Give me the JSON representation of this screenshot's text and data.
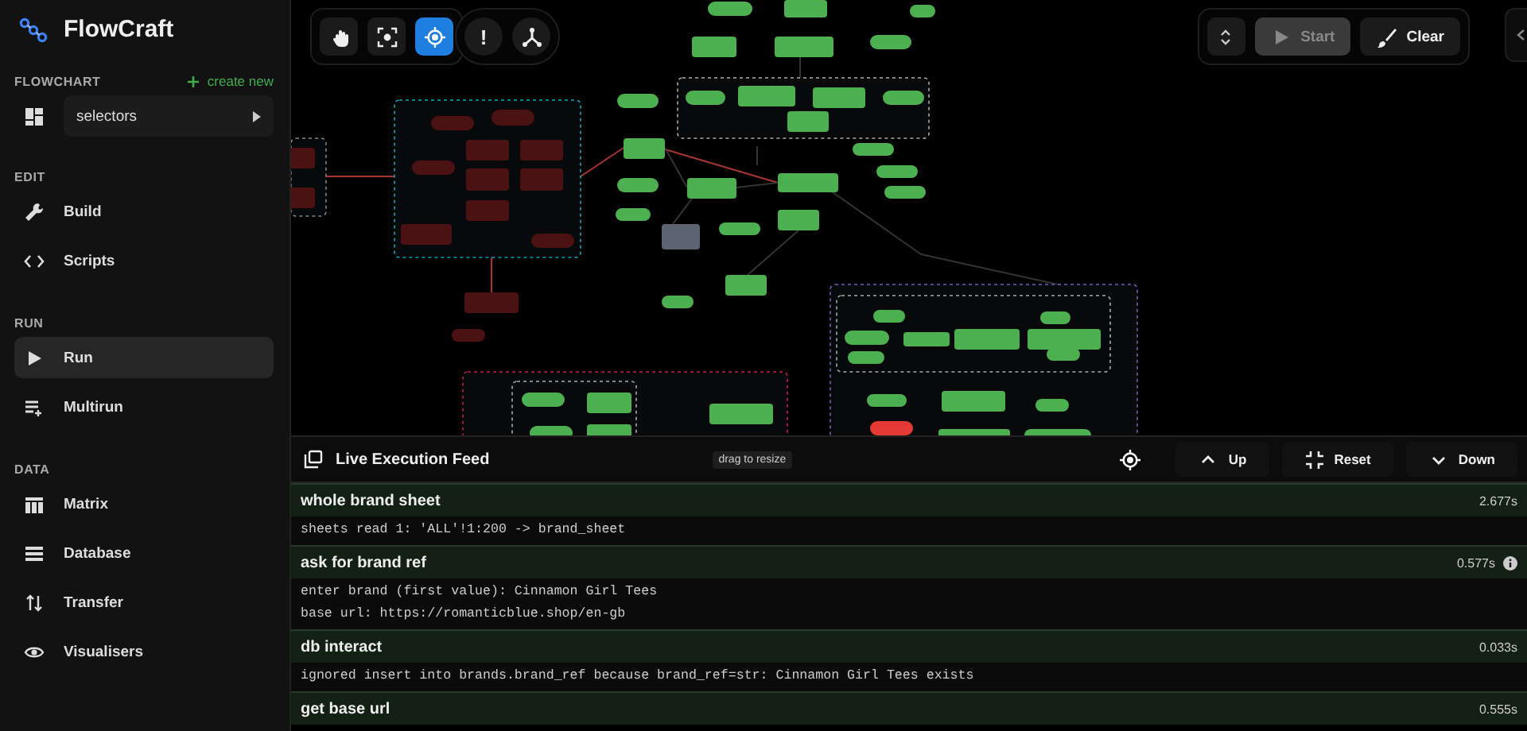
{
  "app": {
    "name": "FlowCraft"
  },
  "sidebar": {
    "sections": [
      {
        "title": "FLOWCHART",
        "action": "create new",
        "items": [
          {
            "label": "selectors",
            "kind": "picker",
            "selected": false
          }
        ]
      },
      {
        "title": "EDIT",
        "items": [
          {
            "label": "Build",
            "kind": "nav",
            "selected": false
          },
          {
            "label": "Scripts",
            "kind": "nav",
            "selected": false
          }
        ]
      },
      {
        "title": "RUN",
        "items": [
          {
            "label": "Run",
            "kind": "nav",
            "selected": true
          },
          {
            "label": "Multirun",
            "kind": "nav",
            "selected": false
          }
        ]
      },
      {
        "title": "DATA",
        "items": [
          {
            "label": "Matrix",
            "kind": "nav",
            "selected": false
          },
          {
            "label": "Database",
            "kind": "nav",
            "selected": false
          },
          {
            "label": "Transfer",
            "kind": "nav",
            "selected": false
          },
          {
            "label": "Visualisers",
            "kind": "nav",
            "selected": false
          }
        ]
      }
    ]
  },
  "canvas_tools": [
    {
      "selected": false
    },
    {
      "selected": false
    },
    {
      "selected": true
    }
  ],
  "canvas_toggles": [
    {
      "kind": "glyph",
      "glyph": "!"
    },
    {
      "kind": "icon"
    }
  ],
  "run_controls": [
    {
      "kind": "icon",
      "disabled": false
    },
    {
      "kind": "text",
      "label": "Start",
      "disabled": true
    },
    {
      "kind": "text",
      "label": "Clear",
      "disabled": false
    }
  ],
  "feed": {
    "title": "Live Execution Feed",
    "resize_hint": "drag to resize",
    "buttons": [
      {
        "label": "Up"
      },
      {
        "label": "Reset"
      },
      {
        "label": "Down"
      }
    ],
    "entries": [
      {
        "title": "whole brand sheet",
        "time": "2.677s",
        "info": false,
        "lines": [
          "sheets read 1: 'ALL'!1:200 -> brand_sheet"
        ]
      },
      {
        "title": "ask for brand ref",
        "time": "0.577s",
        "info": true,
        "lines": [
          "enter brand (first value): Cinnamon Girl Tees",
          "base url: https://romanticblue.shop/en-gb"
        ]
      },
      {
        "title": "db interact",
        "time": "0.033s",
        "info": false,
        "lines": [
          "ignored insert into brands.brand_ref because brand_ref=str: Cinnamon Girl Tees exists"
        ]
      },
      {
        "title": "get base url",
        "time": "0.555s",
        "info": false
      }
    ]
  }
}
